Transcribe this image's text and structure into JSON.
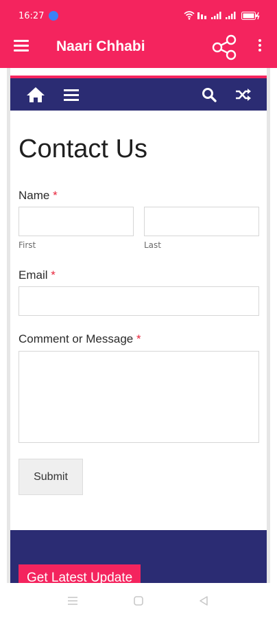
{
  "status_bar": {
    "time": "16:27",
    "icons": [
      "wifi-icon",
      "vowifi-icon",
      "signal-icon",
      "signal-icon",
      "battery-icon"
    ]
  },
  "app_bar": {
    "title": "Naari Chhabi",
    "background": "#f4245e"
  },
  "site_nav": {
    "background": "#2b2c73",
    "icons": [
      "home-icon",
      "menu-icon",
      "search-icon",
      "shuffle-icon"
    ]
  },
  "contact_form": {
    "heading": "Contact Us",
    "required_mark": "*",
    "name_label": "Name",
    "first_sublabel": "First",
    "last_sublabel": "Last",
    "first_value": "",
    "last_value": "",
    "email_label": "Email",
    "email_value": "",
    "message_label": "Comment or Message",
    "message_value": "",
    "submit_label": "Submit"
  },
  "footer": {
    "button_label": "Get Latest Update"
  },
  "system_nav": {
    "icons": [
      "recents-icon",
      "home-square-icon",
      "back-triangle-icon"
    ]
  }
}
